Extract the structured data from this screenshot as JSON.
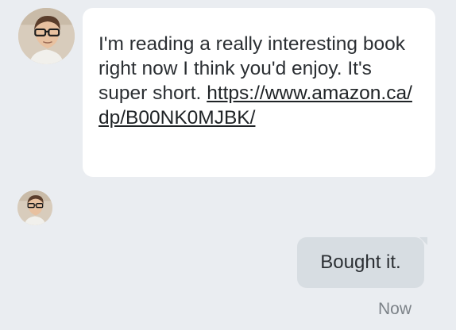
{
  "conversation": {
    "incoming": {
      "avatar_icon": "user-avatar-man-glasses",
      "text": "I'm reading a really interesting book right now I think you'd enjoy. It's super short. ",
      "link_text": "https://www.amazon.ca/dp/B00NK0MJBK/",
      "link_href": "https://www.amazon.ca/dp/B00NK0MJBK/"
    },
    "read_receipt": {
      "avatar_icon": "read-receipt-avatar"
    },
    "outgoing": {
      "text": "Bought it.",
      "timestamp": "Now"
    }
  },
  "colors": {
    "background": "#eaedf1",
    "incoming_bubble": "#ffffff",
    "outgoing_bubble": "#d7dde2",
    "text": "#2b2f33",
    "timestamp": "#7c8288"
  }
}
